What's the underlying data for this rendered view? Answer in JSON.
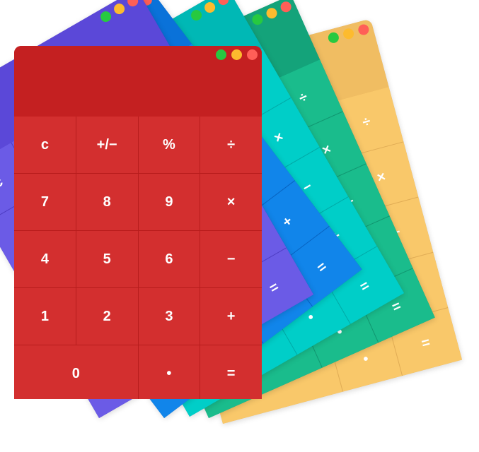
{
  "lights": [
    {
      "name": "green",
      "color": "#27c940"
    },
    {
      "name": "yellow",
      "color": "#fdbb2e"
    },
    {
      "name": "red",
      "color": "#ff5f57"
    }
  ],
  "calculators": [
    {
      "id": "calc-yellow",
      "theme": "yellow",
      "display": "#f0bd62",
      "keys_bg": "#f9c86a",
      "gap": "#e0ac55"
    },
    {
      "id": "calc-green",
      "theme": "green",
      "display": "#14a37a",
      "keys_bg": "#1abc8c",
      "gap": "#119670"
    },
    {
      "id": "calc-teal",
      "theme": "teal",
      "display": "#00b8b5",
      "keys_bg": "#00cec8",
      "gap": "#01a9a6"
    },
    {
      "id": "calc-blue",
      "theme": "blue",
      "display": "#0a72d9",
      "keys_bg": "#1185ea",
      "gap": "#0863c0"
    },
    {
      "id": "calc-purple",
      "theme": "purple",
      "display": "#5b48d8",
      "keys_bg": "#6b5be6",
      "gap": "#4d3cc2"
    },
    {
      "id": "calc-red",
      "theme": "red",
      "display": "#c42021",
      "keys_bg": "#d32f2f",
      "gap": "#b71c1c"
    }
  ],
  "keys": [
    {
      "label": "c",
      "name": "clear"
    },
    {
      "label": "+/−",
      "name": "sign"
    },
    {
      "label": "%",
      "name": "percent"
    },
    {
      "label": "÷",
      "name": "divide"
    },
    {
      "label": "7",
      "name": "7"
    },
    {
      "label": "8",
      "name": "8"
    },
    {
      "label": "9",
      "name": "9"
    },
    {
      "label": "×",
      "name": "multiply"
    },
    {
      "label": "4",
      "name": "4"
    },
    {
      "label": "5",
      "name": "5"
    },
    {
      "label": "6",
      "name": "6"
    },
    {
      "label": "−",
      "name": "subtract"
    },
    {
      "label": "1",
      "name": "1"
    },
    {
      "label": "2",
      "name": "2"
    },
    {
      "label": "3",
      "name": "3"
    },
    {
      "label": "+",
      "name": "add"
    },
    {
      "label": "0",
      "name": "0",
      "wide": true
    },
    {
      "label": "•",
      "name": "decimal"
    },
    {
      "label": "=",
      "name": "equals"
    }
  ]
}
